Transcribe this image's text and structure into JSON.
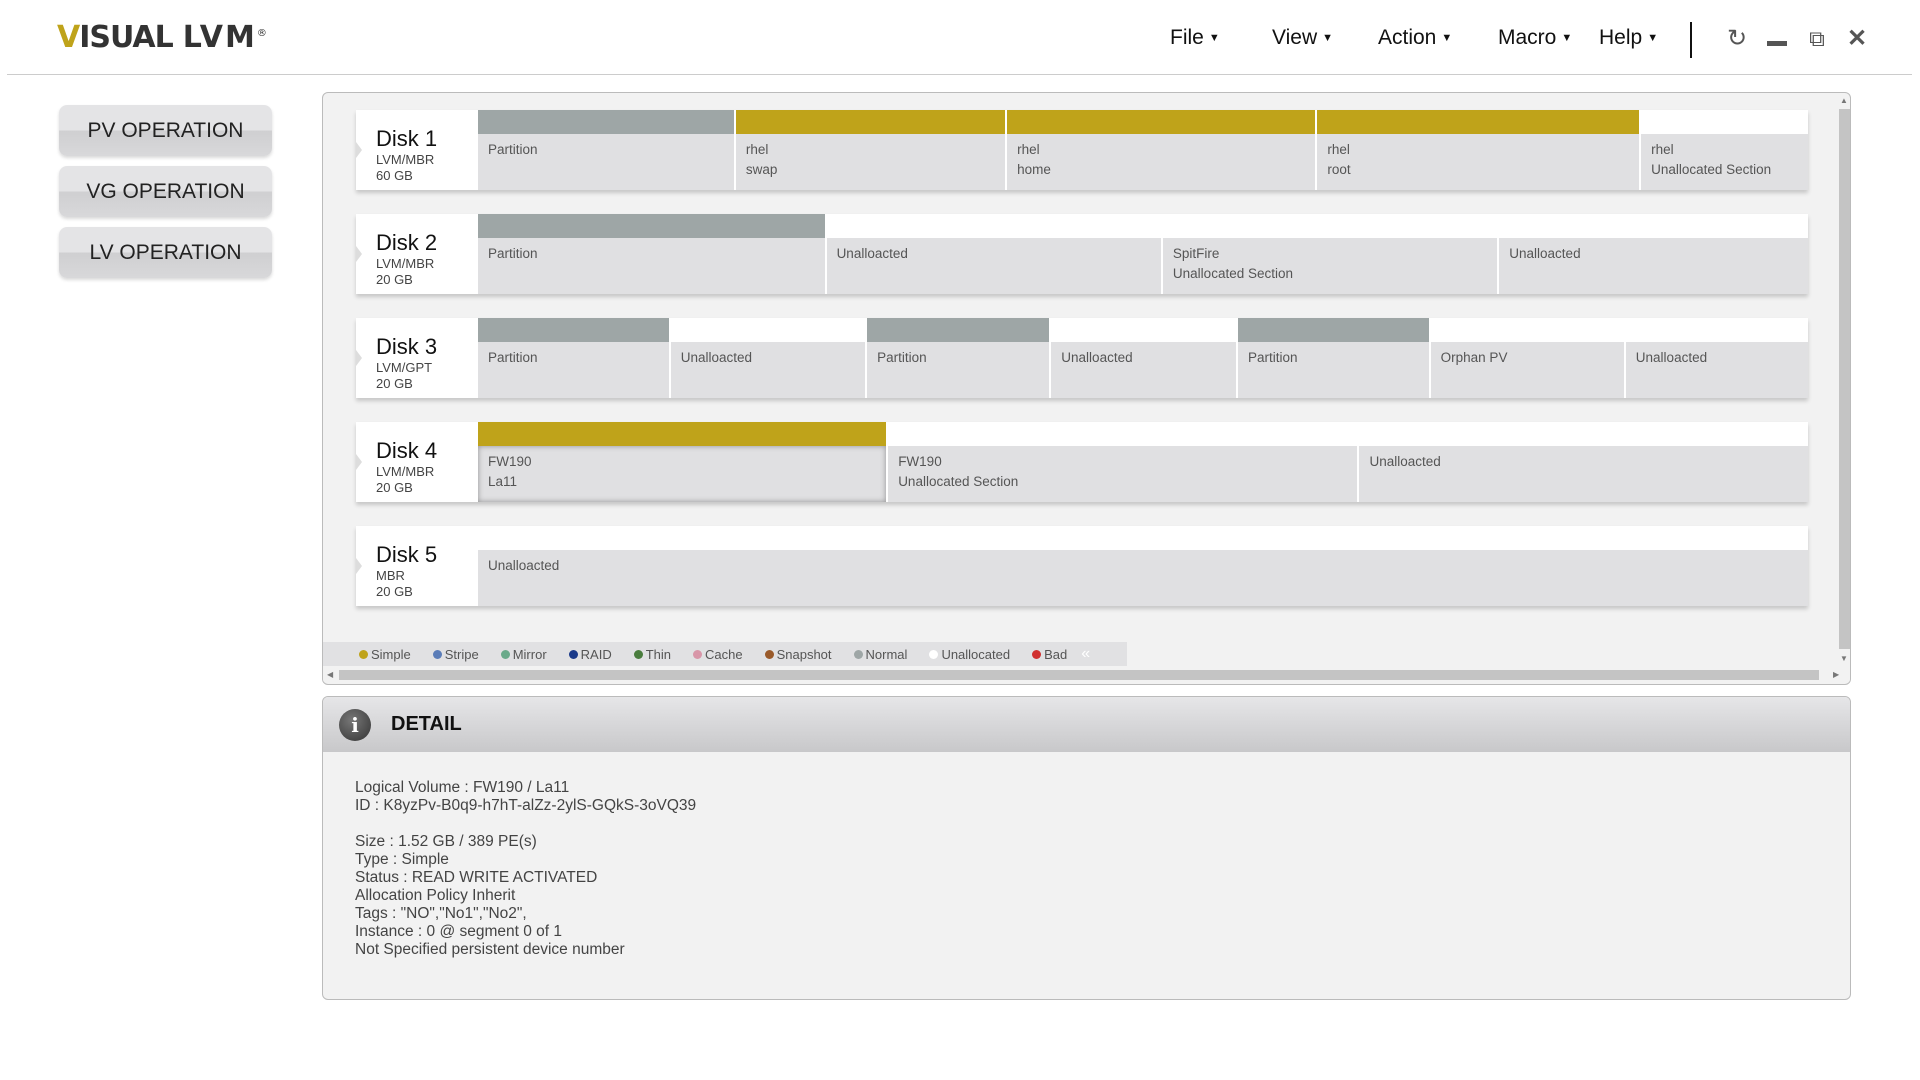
{
  "app": {
    "logo_text": "VISUAL LVM",
    "logo_first": "V",
    "logo_rest": "ISUAL",
    "logo_lvm": "LVM",
    "logo_mark": "®"
  },
  "menu": [
    {
      "label": "File"
    },
    {
      "label": "View"
    },
    {
      "label": "Action"
    },
    {
      "label": "Macro"
    },
    {
      "label": "Help"
    }
  ],
  "window_icons": [
    "refresh-icon",
    "minimize-icon",
    "restore-icon",
    "close-icon"
  ],
  "operations": [
    {
      "label": "PV OPERATION"
    },
    {
      "label": "VG OPERATION"
    },
    {
      "label": "LV OPERATION"
    }
  ],
  "colors": {
    "Simple": "#bfa31a",
    "Stripe": "#5b7db8",
    "Mirror": "#6aaa8a",
    "RAID": "#1b3a8a",
    "Thin": "#4a7d3e",
    "Cache": "#d896a8",
    "Snapshot": "#9a5a2a",
    "Normal": "#9ea6a6",
    "Unallocated": "#ffffff",
    "Bad": "#d03030"
  },
  "disks": [
    {
      "name": "Disk 1",
      "type": "LVM/MBR",
      "size": "60 GB",
      "segments": [
        {
          "kind": "Normal",
          "line1": "Partition",
          "line2": ""
        },
        {
          "kind": "Simple",
          "line1": "rhel",
          "line2": "swap"
        },
        {
          "kind": "Simple",
          "line1": "rhel",
          "line2": "home"
        },
        {
          "kind": "Simple",
          "line1": "rhel",
          "line2": "root"
        },
        {
          "kind": "Unallocated",
          "line1": "rhel",
          "line2": "Unallocated Section"
        }
      ]
    },
    {
      "name": "Disk 2",
      "type": "LVM/MBR",
      "size": "20 GB",
      "segments": [
        {
          "kind": "Normal",
          "line1": "Partition",
          "line2": ""
        },
        {
          "kind": "Unallocated",
          "line1": "Unalloacted",
          "line2": ""
        },
        {
          "kind": "Unallocated",
          "line1": "SpitFire",
          "line2": "Unallocated Section"
        },
        {
          "kind": "Unallocated",
          "line1": "Unalloacted",
          "line2": ""
        }
      ]
    },
    {
      "name": "Disk 3",
      "type": "LVM/GPT",
      "size": "20 GB",
      "segments": [
        {
          "kind": "Normal",
          "line1": "Partition",
          "line2": ""
        },
        {
          "kind": "Unallocated",
          "line1": "Unalloacted",
          "line2": ""
        },
        {
          "kind": "Normal",
          "line1": "Partition",
          "line2": ""
        },
        {
          "kind": "Unallocated",
          "line1": "Unalloacted",
          "line2": ""
        },
        {
          "kind": "Normal",
          "line1": "Partition",
          "line2": ""
        },
        {
          "kind": "Unallocated",
          "line1": "Orphan PV",
          "line2": ""
        },
        {
          "kind": "Unallocated",
          "line1": "Unalloacted",
          "line2": ""
        }
      ]
    },
    {
      "name": "Disk 4",
      "type": "LVM/MBR",
      "size": "20 GB",
      "segments": [
        {
          "kind": "Simple",
          "line1": "FW190",
          "line2": "La11",
          "selected": true
        },
        {
          "kind": "Unallocated",
          "line1": "FW190",
          "line2": "Unallocated Section"
        },
        {
          "kind": "Unallocated",
          "line1": "Unalloacted",
          "line2": ""
        }
      ]
    },
    {
      "name": "Disk 5",
      "type": "MBR",
      "size": "20 GB",
      "segments": [
        {
          "kind": "Unallocated",
          "line1": "Unalloacted",
          "line2": ""
        }
      ]
    }
  ],
  "legend": [
    "Simple",
    "Stripe",
    "Mirror",
    "RAID",
    "Thin",
    "Cache",
    "Snapshot",
    "Normal",
    "Unallocated",
    "Bad"
  ],
  "legend_collapse": "«",
  "detail": {
    "title": "DETAIL",
    "lines_a": [
      "Logical Volume : FW190 / La11",
      "ID : K8yzPv-B0q9-h7hT-alZz-2ylS-GQkS-3oVQ39"
    ],
    "lines_b": [
      "Size : 1.52 GB / 389 PE(s)",
      "Type : Simple",
      "Status : READ WRITE ACTIVATED",
      "Allocation Policy Inherit",
      "Tags : \"NO\",\"No1\",\"No2\",",
      "Instance : 0 @ segment 0 of 1",
      "Not Specified persistent device number"
    ]
  }
}
